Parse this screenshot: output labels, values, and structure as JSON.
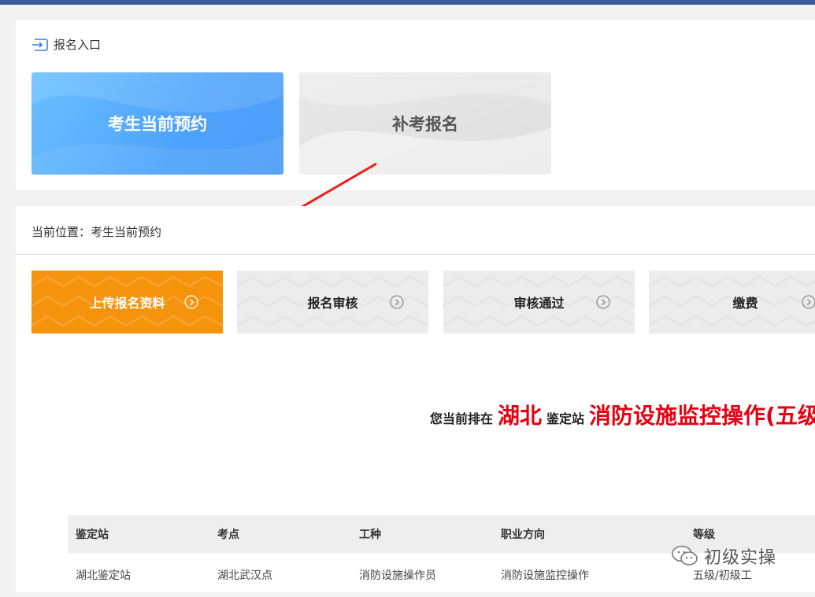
{
  "entry": {
    "title": "报名入口",
    "current_booking": "考生当前预约",
    "makeup_signup": "补考报名"
  },
  "breadcrumb": "当前位置：考生当前预约",
  "steps": [
    {
      "label": "上传报名资料",
      "active": true
    },
    {
      "label": "报名审核",
      "active": false
    },
    {
      "label": "审核通过",
      "active": false
    },
    {
      "label": "缴费",
      "active": false
    }
  ],
  "queue": {
    "prefix": "您当前排在",
    "province": "湖北",
    "middle": "鉴定站",
    "job": "消防设施监控操作(五级"
  },
  "table": {
    "headers": [
      "鉴定站",
      "考点",
      "工种",
      "职业方向",
      "等级"
    ],
    "rows": [
      [
        "湖北鉴定站",
        "湖北武汉点",
        "消防设施操作员",
        "消防设施监控操作",
        "五级/初级工"
      ]
    ]
  },
  "watermark": "初级实操",
  "colors": {
    "topbar": "#3c5a9a",
    "primary_blue": "#4fa2fb",
    "active_step": "#f5930d",
    "highlight_red": "#e60012"
  }
}
